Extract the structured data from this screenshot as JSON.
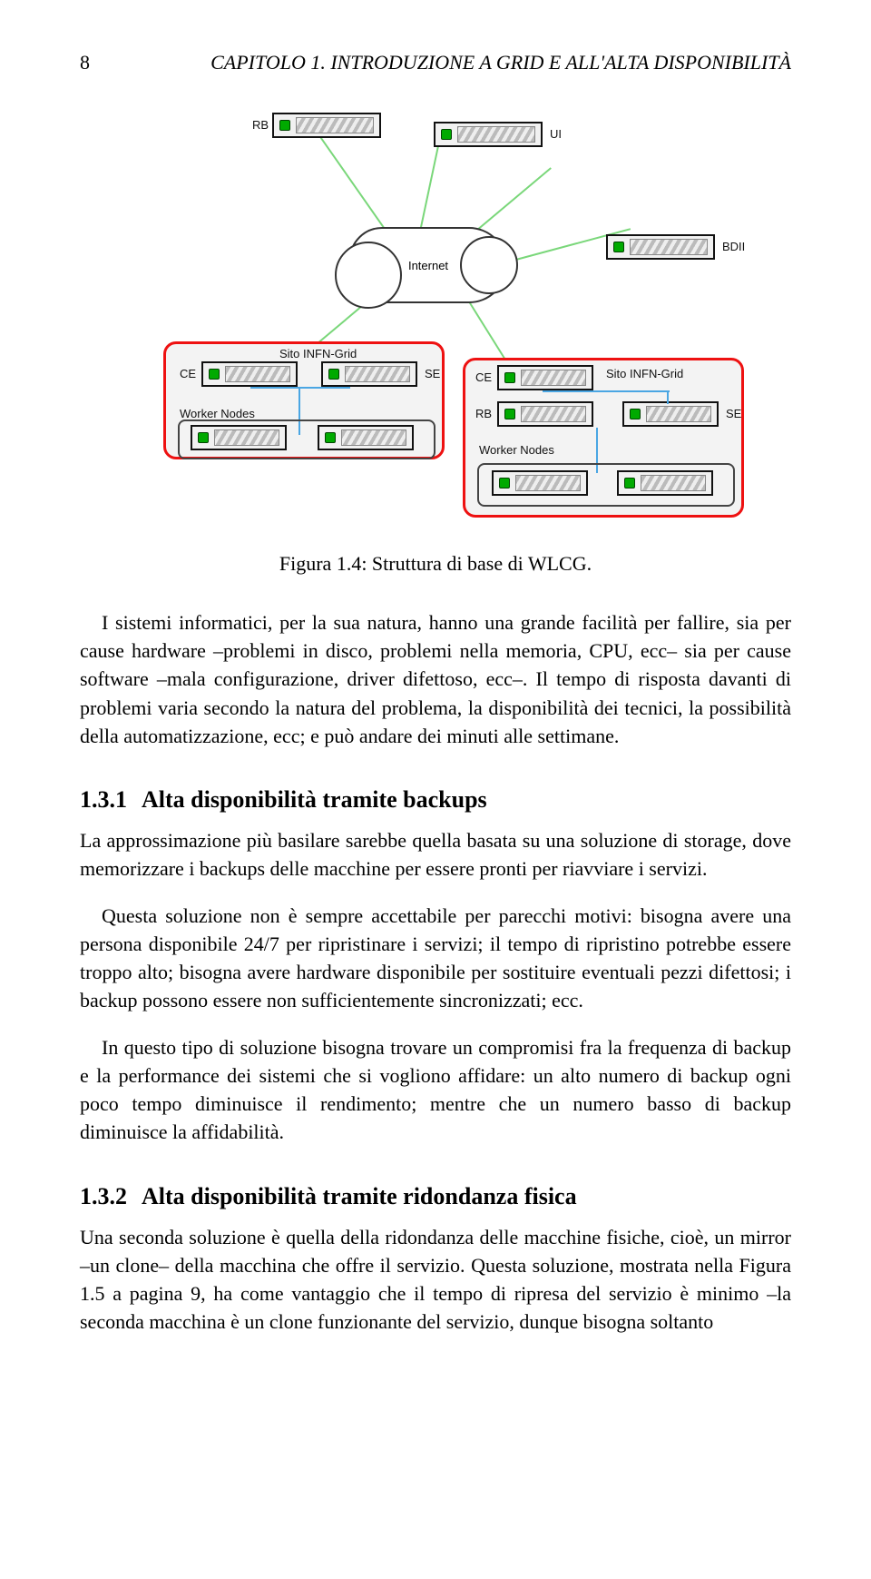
{
  "header": {
    "pagenum": "8",
    "chapter_running": "CAPITOLO 1. INTRODUZIONE A GRID E ALL'ALTA DISPONIBILITÀ"
  },
  "fig": {
    "labels": {
      "rb": "RB",
      "ui": "UI",
      "bdii": "BDII",
      "internet": "Internet",
      "site_label": "Sito INFN-Grid",
      "ce": "CE",
      "se": "SE",
      "wn": "Worker Nodes"
    },
    "caption": "Figura 1.4: Struttura di base di WLCG."
  },
  "body": {
    "p1": "I sistemi informatici, per la sua natura, hanno una grande facilità per fallire, sia per cause hardware –problemi in disco, problemi nella memoria, CPU, ecc– sia per cause software –mala configurazione, driver difettoso, ecc–. Il tempo di risposta davanti di problemi varia secondo la natura del problema, la disponibilità dei tecnici, la possibilità della automatizzazione, ecc; e può andare dei minuti alle settimane.",
    "s131": {
      "num": "1.3.1",
      "title": "Alta disponibilità tramite backups"
    },
    "p2": "La approssimazione più basilare sarebbe quella basata su una soluzione di storage, dove memorizzare i backups delle macchine per essere pronti per riavviare i servizi.",
    "p3": "Questa soluzione non è sempre accettabile per parecchi motivi: bisogna avere una persona disponibile 24/7 per ripristinare i servizi; il tempo di ripristino potrebbe essere troppo alto; bisogna avere hardware disponibile per sostituire eventuali pezzi difettosi; i backup possono essere non sufficientemente sincronizzati; ecc.",
    "p4": "In questo tipo di soluzione bisogna trovare un compromisi fra la frequenza di backup e la performance dei sistemi che si vogliono affidare: un alto numero di backup ogni poco tempo diminuisce il rendimento; mentre che un numero basso di backup diminuisce la affidabilità.",
    "s132": {
      "num": "1.3.2",
      "title": "Alta disponibilità tramite ridondanza fisica"
    },
    "p5": "Una seconda soluzione è quella della ridondanza delle macchine fisiche, cioè, un mirror –un clone– della macchina che offre il servizio. Questa soluzione, mostrata nella Figura 1.5 a pagina 9, ha come vantaggio che il tempo di ripresa del servizio è minimo –la seconda macchina è un clone funzionante del servizio, dunque bisogna soltanto"
  }
}
